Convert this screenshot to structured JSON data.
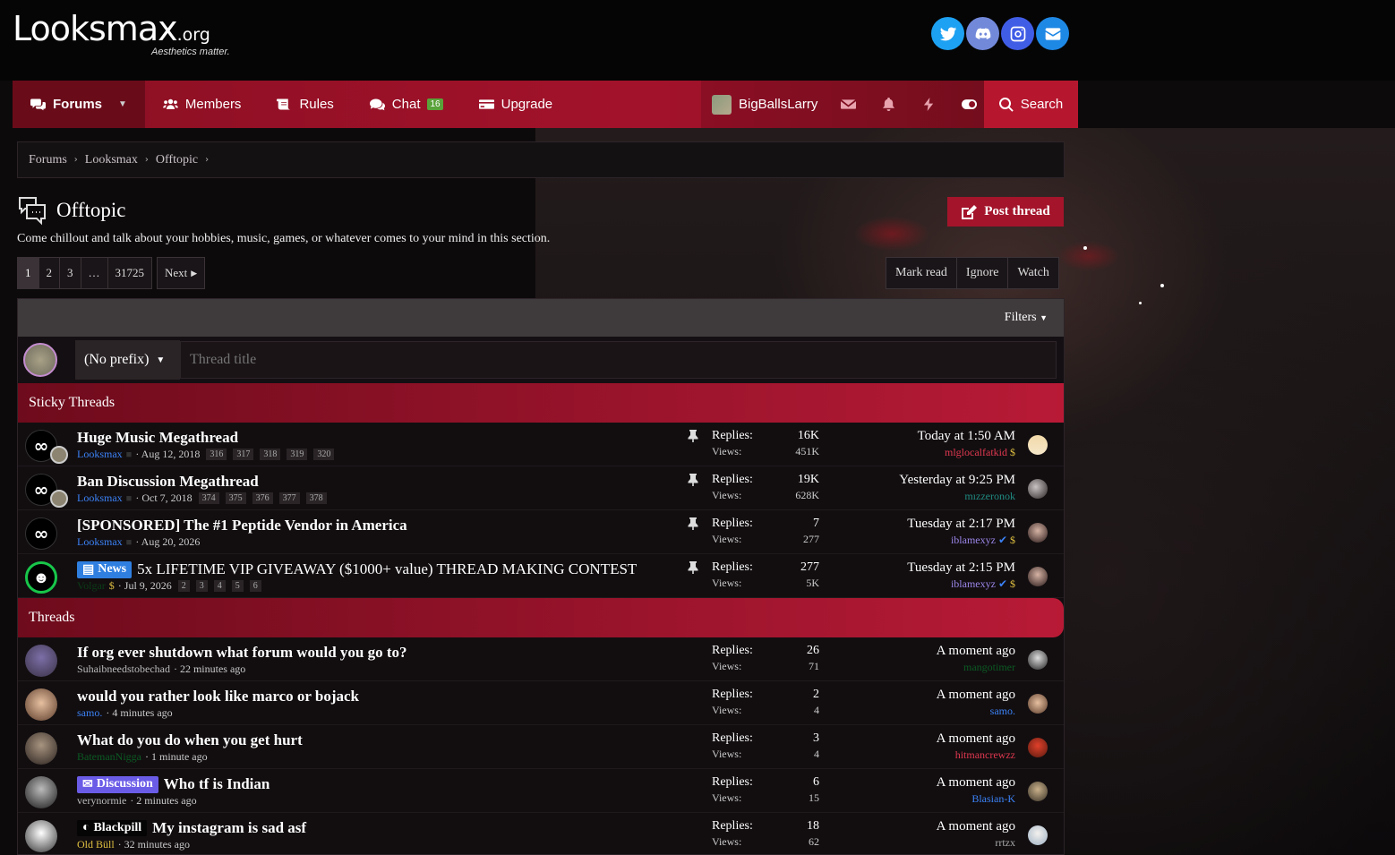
{
  "header": {
    "logo_main": "Looksmax",
    "logo_suffix": ".org",
    "tagline": "Aesthetics matter."
  },
  "socials": [
    {
      "name": "twitter-icon",
      "color": "#1da1f2"
    },
    {
      "name": "discord-icon",
      "color": "#7289da"
    },
    {
      "name": "instagram-icon",
      "color": "#405de6"
    },
    {
      "name": "mail-icon",
      "color": "#1e88e5"
    }
  ],
  "nav": {
    "forums": "Forums",
    "members": "Members",
    "rules": "Rules",
    "chat": "Chat",
    "chat_badge": "16",
    "upgrade": "Upgrade",
    "username": "BigBallsLarry",
    "search": "Search"
  },
  "breadcrumb": [
    "Forums",
    "Looksmax",
    "Offtopic"
  ],
  "forum": {
    "title": "Offtopic",
    "description": "Come chillout and talk about your hobbies, music, games, or whatever comes to your mind in this section.",
    "post_thread": "Post thread"
  },
  "pager": {
    "pages": [
      "1",
      "2",
      "3",
      "…",
      "31725"
    ],
    "next": "Next"
  },
  "actions": [
    "Mark read",
    "Ignore",
    "Watch"
  ],
  "filters": "Filters",
  "quick_thread": {
    "prefix": "(No prefix)",
    "placeholder": "Thread title"
  },
  "sections": {
    "sticky": "Sticky Threads",
    "threads": "Threads"
  },
  "labels": {
    "replies": "Replies:",
    "views": "Views:"
  },
  "sticky_threads": [
    {
      "title": "Huge Music Megathread",
      "author": "Looksmax",
      "date": "· Aug 12, 2018",
      "pages": [
        "316",
        "317",
        "318",
        "319",
        "320"
      ],
      "replies": "16K",
      "views": "451K",
      "last_time": "Today at 1:50 AM",
      "last_user": "mlglocalfatkid"
    },
    {
      "title": "Ban Discussion Megathread",
      "author": "Looksmax",
      "date": "· Oct 7, 2018",
      "pages": [
        "374",
        "375",
        "376",
        "377",
        "378"
      ],
      "replies": "19K",
      "views": "628K",
      "last_time": "Yesterday at 9:25 PM",
      "last_user": "mızzeronok"
    },
    {
      "title": "[SPONSORED] The #1 Peptide Vendor in America",
      "author": "Looksmax",
      "date": "· Aug 20, 2026",
      "pages": [],
      "replies": "7",
      "views": "277",
      "last_time": "Tuesday at 2:17 PM",
      "last_user": "iblamexyz"
    },
    {
      "title": "5x LIFETIME VIP GIVEAWAY ($1000+ value) THREAD MAKING CONTEST",
      "prefix": "News",
      "author": "Volgar",
      "date": "· Jul 9, 2026",
      "pages": [
        "2",
        "3",
        "4",
        "5",
        "6"
      ],
      "replies": "277",
      "views": "5K",
      "last_time": "Tuesday at 2:15 PM",
      "last_user": "iblamexyz"
    }
  ],
  "threads": [
    {
      "title": "If org ever shutdown what forum would you go to?",
      "author": "Suhaibneedstobechad",
      "date": "· 22 minutes ago",
      "replies": "26",
      "views": "71",
      "last_time": "A moment ago",
      "last_user": "mangotimer"
    },
    {
      "title": "would you rather look like marco or bojack",
      "author": "samo.",
      "date": "· 4 minutes ago",
      "replies": "2",
      "views": "4",
      "last_time": "A moment ago",
      "last_user": "samo."
    },
    {
      "title": "What do you do when you get hurt",
      "author": "BatemanNigga",
      "date": "· 1 minute ago",
      "replies": "3",
      "views": "4",
      "last_time": "A moment ago",
      "last_user": "hitmancrewzz"
    },
    {
      "title": "Who tf is Indian",
      "prefix": "Discussion",
      "author": "verynormie",
      "date": "· 2 minutes ago",
      "replies": "6",
      "views": "15",
      "last_time": "A moment ago",
      "last_user": "Blasian-K"
    },
    {
      "title": "My instagram is sad asf",
      "prefix": "Blackpill",
      "author": "Old Büll",
      "date": "· 32 minutes ago",
      "replies": "18",
      "views": "62",
      "last_time": "A moment ago",
      "last_user": "rrtzx"
    }
  ]
}
